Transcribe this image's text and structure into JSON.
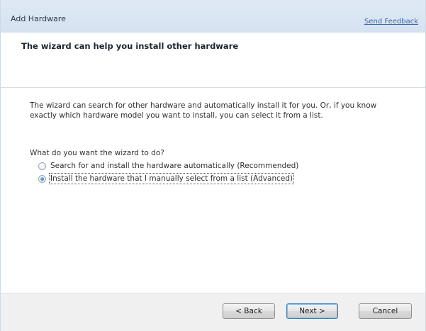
{
  "window": {
    "title": "Add Hardware",
    "feedback_link": "Send Feedback"
  },
  "header": {
    "title": "The wizard can help you install other hardware"
  },
  "body": {
    "description": "The wizard can search for other hardware and automatically install it for you. Or, if you know exactly which hardware model you want to install, you can select it from a list.",
    "question": "What do you want the wizard to do?",
    "options": [
      {
        "label": "Search for and install the hardware automatically (Recommended)",
        "selected": false
      },
      {
        "label": "Install the hardware that I manually select from a list (Advanced)",
        "selected": true
      }
    ]
  },
  "footer": {
    "back_label": "< Back",
    "next_label": "Next >",
    "cancel_label": "Cancel"
  },
  "colors": {
    "titlebar": "#d6e2f1",
    "link": "#3c6aa8",
    "footer": "#f0f0f0"
  }
}
